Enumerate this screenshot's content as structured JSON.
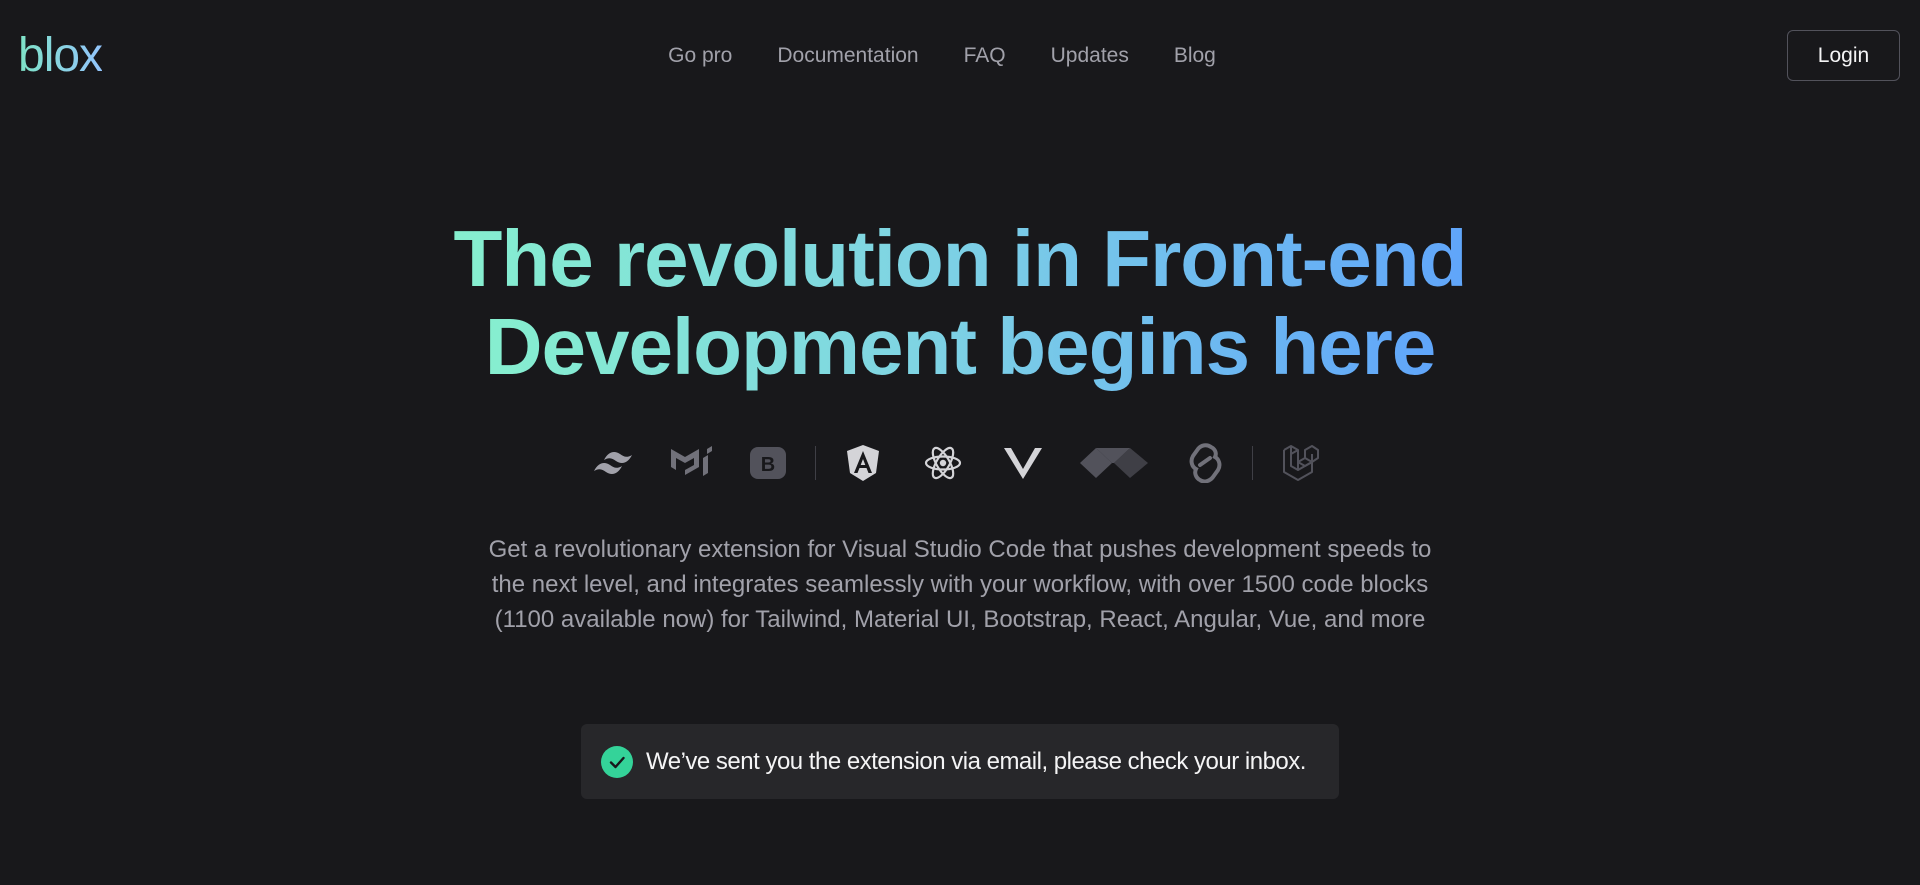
{
  "header": {
    "logo_text": "blox",
    "nav": [
      {
        "label": "Go pro"
      },
      {
        "label": "Documentation"
      },
      {
        "label": "FAQ"
      },
      {
        "label": "Updates"
      },
      {
        "label": "Blog"
      }
    ],
    "login_label": "Login"
  },
  "hero": {
    "title_line1": "The revolution in Front-end",
    "title_line2": "Development begins here",
    "description": "Get a revolutionary extension for Visual Studio Code that pushes development speeds to the next level, and integrates seamlessly with your workflow, with over 1500 code blocks (1100 available now) for Tailwind, Material UI, Bootstrap, React, Angular, Vue, and more"
  },
  "framework_logos": [
    {
      "icon": "tailwind-icon"
    },
    {
      "icon": "material-ui-icon"
    },
    {
      "icon": "bootstrap-icon"
    },
    {
      "icon": "angular-icon"
    },
    {
      "icon": "react-icon"
    },
    {
      "icon": "vue-icon"
    },
    {
      "icon": "alpine-icon"
    },
    {
      "icon": "svelte-icon"
    },
    {
      "icon": "laravel-icon"
    }
  ],
  "toast": {
    "icon": "check-circle-icon",
    "message": "We’ve sent you the extension via email, please check your inbox."
  },
  "colors": {
    "background": "#18181b",
    "nav_text": "#a1a1aa",
    "gradient_start": "#86efcf",
    "gradient_end": "#60a5fa",
    "toast_bg": "#27272a",
    "success": "#34d399",
    "logo_gray": "#71717a"
  }
}
